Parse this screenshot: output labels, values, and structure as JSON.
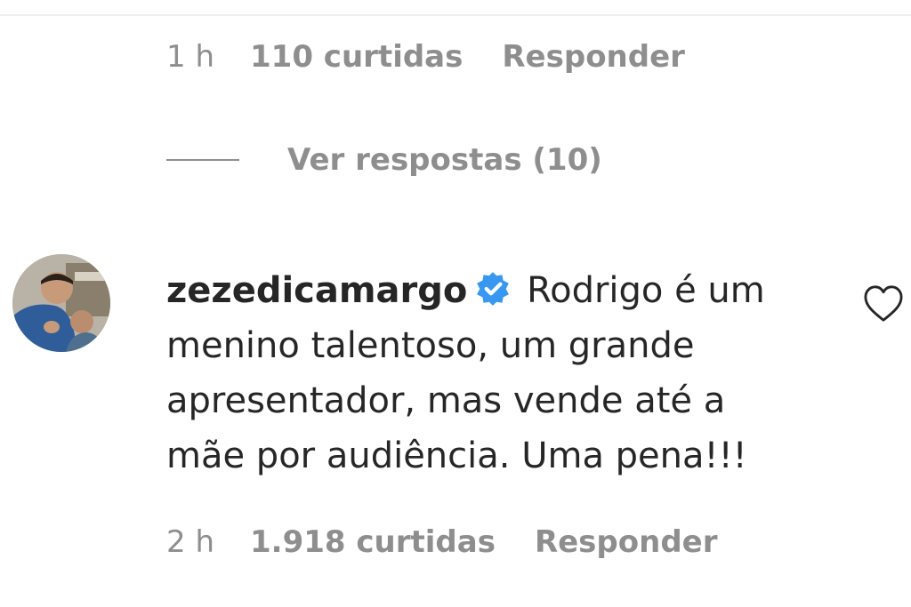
{
  "previous_comment": {
    "time": "1 h",
    "likes": "110 curtidas",
    "reply_label": "Responder"
  },
  "view_replies": {
    "label": "Ver respostas (10)"
  },
  "comment": {
    "username": "zezedicamargo",
    "verified_icon": "verified-badge-icon",
    "text": "Rodrigo é um menino talentoso, um grande apresentador, mas vende até a mãe por audiência. Uma pena!!!",
    "time": "2 h",
    "likes": "1.918 curtidas",
    "reply_label": "Responder"
  },
  "icons": {
    "like": "heart-outline-icon"
  },
  "colors": {
    "meta_gray": "#8e8e8e",
    "text": "#262626",
    "verified_blue": "#3897f0"
  }
}
